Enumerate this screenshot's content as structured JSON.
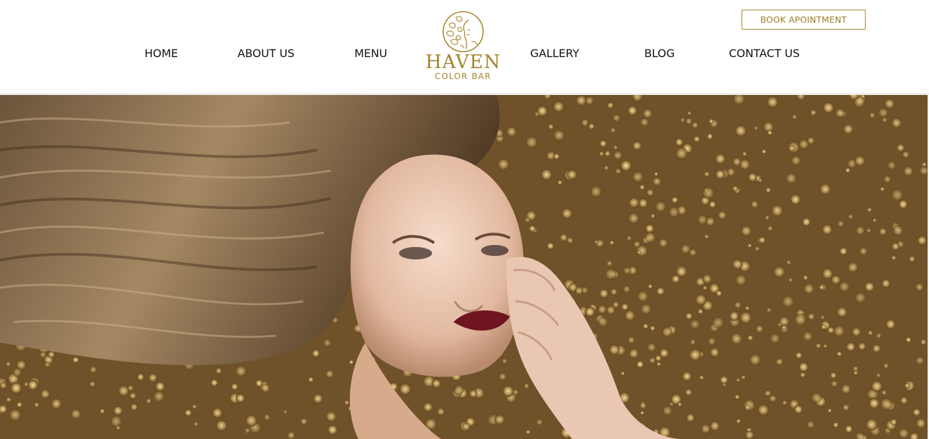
{
  "header": {
    "book_button": "BOOK APOINTMENT",
    "nav": {
      "home": "HOME",
      "about": "ABOUT US",
      "menu": "MENU",
      "gallery": "GALLERY",
      "blog": "BLOG",
      "contact": "CONTACT US"
    },
    "logo": {
      "name": "HAVEN",
      "tagline": "COLOR BAR",
      "icon": "woman-face-leaves-icon"
    }
  },
  "hero": {
    "image": "woman-with-long-hair-on-gold-sequins-photo"
  },
  "colors": {
    "brand_gold": "#a4852b",
    "nav_text": "#111111",
    "background": "#ffffff"
  }
}
